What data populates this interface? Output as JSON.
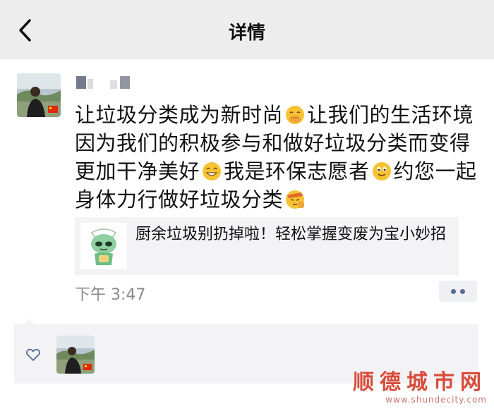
{
  "header": {
    "title": "详情",
    "back_icon": "chevron-left-icon",
    "background": "#ededed"
  },
  "post": {
    "text_segments": [
      "让垃圾分类成为新时尚",
      "让我们的生活环境因为我们的积极参与和做好垃圾分类而变得更加干净美好",
      "我是环保志愿者",
      "约您一起身体力行做好垃圾分类"
    ],
    "emojis": [
      "covering-mouth-emoji",
      "grin-emoji",
      "smiley-emoji",
      "salute-emoji"
    ],
    "link": {
      "title": "厨余垃圾别扔掉啦！轻松掌握变废为宝小妙招",
      "thumbnail_icon": "mascot-icon"
    },
    "time": "下午 3:47",
    "more_icon": "more-dots-icon"
  },
  "likes": {
    "heart_icon": "heart-outline-icon"
  },
  "watermark": {
    "main": "顺德城市网",
    "url": "www.shundecity.com"
  },
  "colors": {
    "link_blue": "#586b95",
    "panel_bg": "#f3f3f5",
    "watermark_red": "#d94b3a"
  }
}
